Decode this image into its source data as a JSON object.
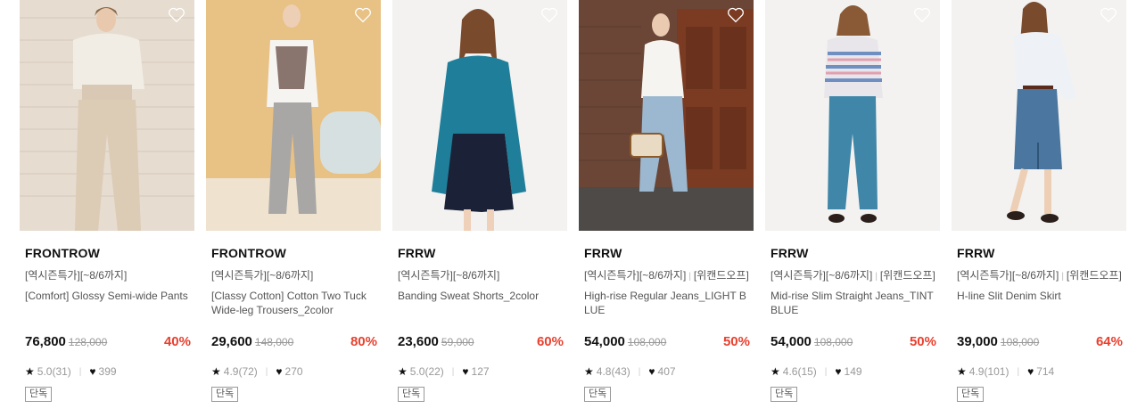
{
  "colors": {
    "discount": "#e8402e",
    "price": "#111111",
    "muted": "#999999"
  },
  "products": [
    {
      "brand": "FRONTROW",
      "tags": [
        "[역시즌특가][~8/6까지]"
      ],
      "name": "[Comfort] Glossy Semi-wide Pants",
      "price": "76,800",
      "original_price": "128,000",
      "discount": "40%",
      "rating": "5.0(31)",
      "likes": "399",
      "badge": "단독",
      "wish_icon": "heart-outline-icon"
    },
    {
      "brand": "FRONTROW",
      "tags": [
        "[역시즌특가][~8/6까지]"
      ],
      "name": "[Classy Cotton] Cotton Two Tuck Wide-leg Trousers_2color",
      "price": "29,600",
      "original_price": "148,000",
      "discount": "80%",
      "rating": "4.9(72)",
      "likes": "270",
      "badge": "단독",
      "wish_icon": "heart-outline-icon"
    },
    {
      "brand": "FRRW",
      "tags": [
        "[역시즌특가][~8/6까지]"
      ],
      "name": "Banding Sweat Shorts_2color",
      "price": "23,600",
      "original_price": "59,000",
      "discount": "60%",
      "rating": "5.0(22)",
      "likes": "127",
      "badge": "단독",
      "wish_icon": "heart-outline-icon"
    },
    {
      "brand": "FRRW",
      "tags": [
        "[역시즌특가][~8/6까지]",
        "[위캔드오프]"
      ],
      "name": "High-rise Regular Jeans_LIGHT BLUE",
      "price": "54,000",
      "original_price": "108,000",
      "discount": "50%",
      "rating": "4.8(43)",
      "likes": "407",
      "badge": "단독",
      "wish_icon": "heart-outline-icon"
    },
    {
      "brand": "FRRW",
      "tags": [
        "[역시즌특가][~8/6까지]",
        "[위캔드오프]"
      ],
      "name": "Mid-rise Slim Straight Jeans_TINT BLUE",
      "price": "54,000",
      "original_price": "108,000",
      "discount": "50%",
      "rating": "4.6(15)",
      "likes": "149",
      "badge": "단독",
      "wish_icon": "heart-outline-icon"
    },
    {
      "brand": "FRRW",
      "tags": [
        "[역시즌특가][~8/6까지]",
        "[위캔드오프]"
      ],
      "name": "H-line Slit Denim Skirt",
      "price": "39,000",
      "original_price": "108,000",
      "discount": "64%",
      "rating": "4.9(101)",
      "likes": "714",
      "badge": "단독",
      "wish_icon": "heart-outline-icon"
    }
  ]
}
